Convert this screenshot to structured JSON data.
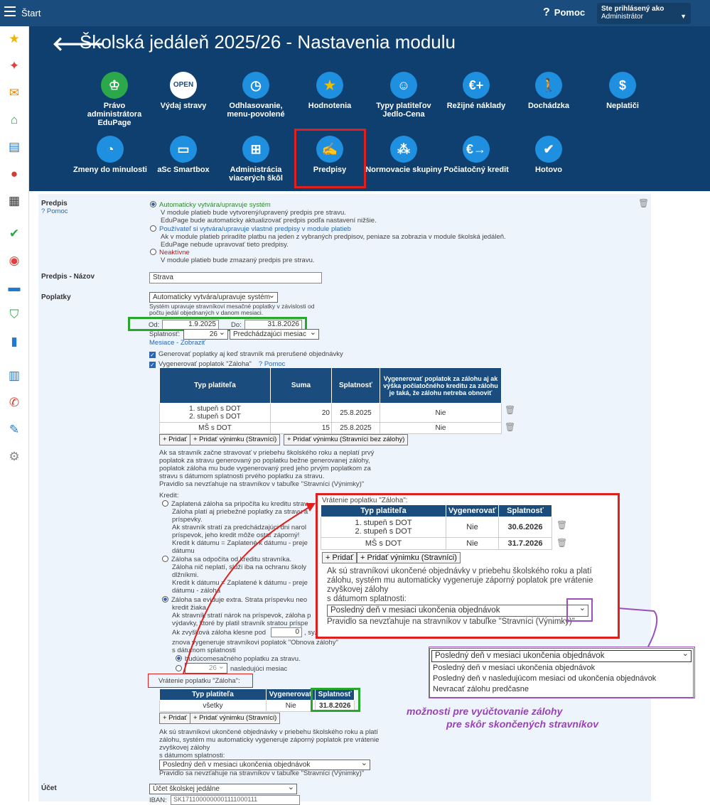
{
  "topbar": {
    "start_label": "Štart",
    "help_label": "Pomoc",
    "user_line1": "Ste prihlásený ako",
    "user_line2": "Administrátor"
  },
  "header": {
    "title": "Školská jedáleň 2025/26 - Nastavenia modulu"
  },
  "tiles": [
    {
      "label": "Právo administrátora EduPage",
      "icon": "admin-icon"
    },
    {
      "label": "Výdaj stravy",
      "icon": "open-sign-icon"
    },
    {
      "label": "Odhlasovanie, menu-povolené",
      "icon": "clock-icon"
    },
    {
      "label": "Hodnotenia",
      "icon": "star-icon"
    },
    {
      "label": "Typy platiteľov Jedlo-Cena",
      "icon": "user-money-icon"
    },
    {
      "label": "Režijné náklady",
      "icon": "euro-plus-icon"
    },
    {
      "label": "Dochádzka",
      "icon": "walk-icon"
    },
    {
      "label": "Neplatiči",
      "icon": "moneybag-icon"
    },
    {
      "label": "Zmeny do minulosti",
      "icon": "history-icon"
    },
    {
      "label": "aSc Smartbox",
      "icon": "monitor-icon"
    },
    {
      "label": "Administrácia viacerých škôl",
      "icon": "hierarchy-icon"
    },
    {
      "label": "Predpisy",
      "icon": "handshake-icon"
    },
    {
      "label": "Normovacie skupiny",
      "icon": "groups-icon"
    },
    {
      "label": "Počiatočný kredit",
      "icon": "euro-arrow-icon"
    },
    {
      "label": "Hotovo",
      "icon": "check-icon"
    }
  ],
  "form": {
    "predpis_label": "Predpis",
    "help_link": "? Pomoc",
    "opt1": "Automaticky vytvára/upravuje systém",
    "opt1_desc1": "V module platieb bude vytvorený/upravený predpis pre stravu.",
    "opt1_desc2": "EduPage bude automaticky aktualizovať predpis podľa nastavení nižšie.",
    "opt2": "Používateľ si vytvára/upravuje vlastné predpisy v module platieb",
    "opt2_desc1": "Ak v module platieb priradíte platbu na jeden z vybraných predpisov, peniaze sa zobrazia v module školská jedáleň.",
    "opt2_desc2": "EduPage nebude upravovať tieto predpisy.",
    "opt3": "Neaktívne",
    "opt3_desc": "V module platieb bude zmazaný predpis pre stravu.",
    "nazov_label": "Predpis - Názov",
    "nazov_value": "Strava",
    "poplatky_label": "Poplatky",
    "poplatky_select": "Automaticky vytvára/upravuje systém",
    "poplatky_desc1": "Systém upravuje stravníkovi mesačné poplatky v závislosti od",
    "poplatky_desc2": "počtu jedál objednaných v danom mesiaci.",
    "od_label": "Od:",
    "od_value": "1.9.2025",
    "do_label": "Do:",
    "do_value": "31.8.2026",
    "splatnost_label": "Splatnosť:",
    "splatnost_day": "26",
    "splatnost_month": "Predchádzajúci mesiac",
    "mesiace_link": "Mesiace - Zobraziť",
    "cb1": "Generovať poplatky aj keď stravník má prerušené objednávky",
    "cb2": "Vygenerovať poplatok \"Záloha\"",
    "ucet_label": "Účet",
    "ucet_select": "Účet školskej jedálne",
    "iban_label": "IBAN:",
    "iban_value": "SK1711000000001111000111"
  },
  "zaloha_table": {
    "headers": [
      "Typ platiteľa",
      "Suma",
      "Splatnosť",
      "Vygenerovať poplatok za zálohu aj ak výška počiatočného kreditu za zálohu je taká, že zálohu netreba obnoviť"
    ],
    "rows": [
      {
        "typ1": "1. stupeň  s DOT",
        "typ2": "2. stupeň  s DOT",
        "suma": "20",
        "splatnost": "25.8.2025",
        "gen": "Nie"
      },
      {
        "typ1": "MŠ s DOT",
        "typ2": "",
        "suma": "15",
        "splatnost": "25.8.2025",
        "gen": "Nie"
      }
    ]
  },
  "buttons": {
    "pridat": "+ Pridať",
    "vynimka": "+ Pridať výnimku (Stravníci)",
    "vynimka_bez": "+ Pridať výnimku (Stravníci bez zálohy)"
  },
  "info": {
    "l1": "Ak sa stravník začne stravovať v priebehu školského roku a neplatí prvý",
    "l2": "poplatok za stravu generovaný po poplatku bežne generovanej zálohy,",
    "l3": "poplatok záloha mu bude vygenerovaný pred jeho prvým poplatkom za",
    "l4": "stravu s dátumom splatnosti prvého poplatku za stravu.",
    "l5": "Pravidlo sa nevzťahuje na stravníkov v tabuľke \"Stravníci (Výnimky)\""
  },
  "kredit": {
    "label": "Kredit:",
    "a1": "Zaplatená záloha sa pripočíta ku kreditu strav",
    "a2": "Záloha platí aj priebežné poplatky za stravu a",
    "a3": "príspevky.",
    "a4": "Ak stravník stratí za predchádzajúci dni narol",
    "a5": "príspevok, jeho kredit môže ostať záporný!",
    "a6": "Kredit k dátumu = Zaplatené k dátumu - preje",
    "a7": "dátumu",
    "b1": "Záloha sa odpočíta od kreditu stravníka.",
    "b2": "Záloha nič neplatí, slúži iba na ochranu školy",
    "b3": "dlžníkmi.",
    "b4": "Kredit k dátumu = Zaplatené k dátumu - preje",
    "b5": "dátumu - záloha",
    "c1": "Záloha sa eviduje extra. Strata príspevku neo",
    "c2": "kredit žiaka.",
    "c3": "Ak stravník stratí nárok na príspevok, záloha p",
    "c4": "výdavky, ktoré by platil stravník stratou príspe",
    "c5": "Ak zvyšková záloha klesne pod",
    "c5_value": "0",
    "c5_suffix": ", sy...",
    "c6": "znova vygeneruje stravníkovi poplatok \"Obnova zálohy\"",
    "c7": "s dátumom splatnosti",
    "d1": "budúcomesačného poplatku za stravu.",
    "d2_value": "26",
    "d2": "nasledujúci mesiac"
  },
  "vratenie": {
    "label": "Vrátenie poplatku \"Záloha\":",
    "headers": [
      "Typ platiteľa",
      "Vygenerovať",
      "Splatnosť"
    ],
    "row_typ": "všetky",
    "row_gen": "Nie",
    "row_spl": "31.8.2026",
    "info1": "Ak sú stravníkovi ukončené objednávky v priebehu školského roku a platí",
    "info2": "zálohu, systém mu automaticky vygeneruje záporný poplatok pre vrátenie",
    "info3": "zvyškovej zálohy",
    "info4": "s dátumom splatnosti:",
    "select": "Posledný deň v mesiaci ukončenia objednávok",
    "info5": "Pravidlo sa nevzťahuje na stravníkov v tabuľke \"Stravníci (Výnimky)\""
  },
  "popup": {
    "label": "Vrátenie poplatku \"Záloha\":",
    "headers": [
      "Typ platiteľa",
      "Vygenerovať",
      "Splatnosť"
    ],
    "rows": [
      {
        "typ1": "1. stupeň  s DOT",
        "typ2": "2. stupeň  s DOT",
        "gen": "Nie",
        "spl": "30.6.2026"
      },
      {
        "typ1": "MŠ s DOT",
        "typ2": "",
        "gen": "Nie",
        "spl": "31.7.2026"
      }
    ],
    "info1": "Ak sú stravníkovi ukončené objednávky v priebehu školského roku a platí",
    "info2": "zálohu, systém mu automaticky vygeneruje záporný poplatok pre vrátenie",
    "info3": "zvyškovej zálohy",
    "info4": "s dátumom splatnosti:",
    "select": "Posledný deň v mesiaci ukončenia objednávok",
    "info5": "Pravidlo sa nevzťahuje na stravníkov v tabuľke \"Stravníci (Výnimky)\""
  },
  "dropdown": {
    "selected": "Posledný deň v mesiaci ukončenia objednávok",
    "options": [
      "Posledný deň v mesiaci ukončenia objednávok",
      "Posledný deň v nasledujúcom mesiaci od ukončenia objednávok",
      "Nevracať zálohu predčasne"
    ]
  },
  "annotation": {
    "line1": "možnosti pre vyúčtovanie zálohy",
    "line2": "pre skôr skončených stravníkov"
  },
  "colors": {
    "header_bg": "#0e3f6e",
    "topbar_bg": "#1a4c7e",
    "tile_circle": "#1f8fe0",
    "highlight_red": "#e0201f",
    "highlight_green": "#28a82a",
    "highlight_purple": "#9b4fbd"
  }
}
